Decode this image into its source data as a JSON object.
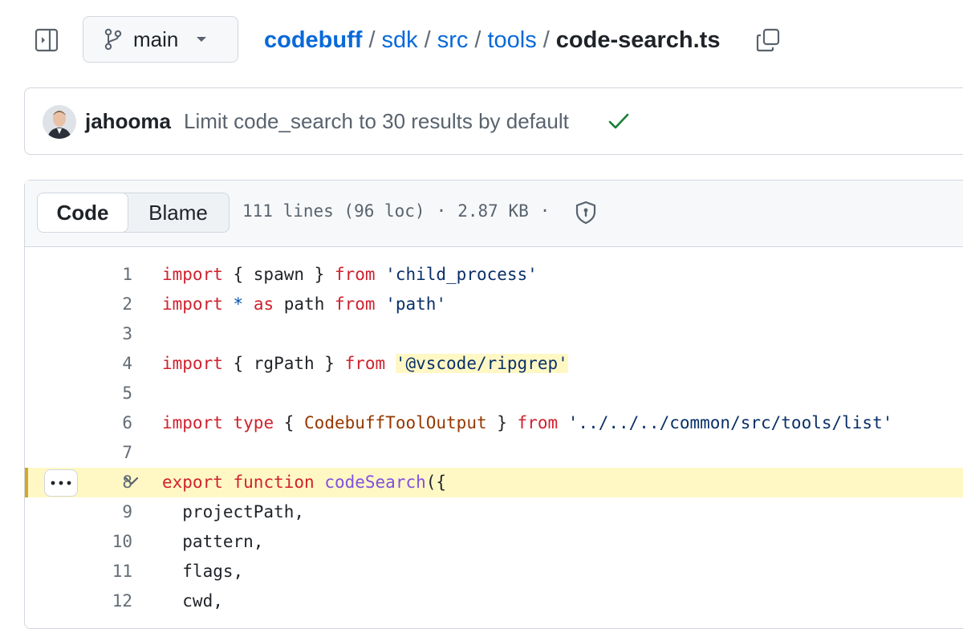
{
  "branch": {
    "name": "main"
  },
  "breadcrumb": {
    "repo": "codebuff",
    "dirs": [
      "sdk",
      "src",
      "tools"
    ],
    "file": "code-search.ts",
    "separator": "/"
  },
  "commit": {
    "author": "jahooma",
    "message": "Limit code_search to 30 results by default",
    "status": "success"
  },
  "file": {
    "tabs": [
      "Code",
      "Blame"
    ],
    "active_tab": "Code",
    "lines_info": "111 lines (96 loc)",
    "size": "2.87 KB",
    "meta_sep": "·"
  },
  "code": {
    "highlighted_line": 8,
    "lines": [
      {
        "num": "1",
        "tokens": [
          [
            "kw",
            "import"
          ],
          [
            "p",
            " { spawn } "
          ],
          [
            "kw",
            "from"
          ],
          [
            "p",
            " "
          ],
          [
            "str",
            "'child_process'"
          ]
        ]
      },
      {
        "num": "2",
        "tokens": [
          [
            "kw",
            "import"
          ],
          [
            "p",
            " "
          ],
          [
            "op",
            "*"
          ],
          [
            "p",
            " "
          ],
          [
            "kw",
            "as"
          ],
          [
            "p",
            " path "
          ],
          [
            "kw",
            "from"
          ],
          [
            "p",
            " "
          ],
          [
            "str",
            "'path'"
          ]
        ]
      },
      {
        "num": "3",
        "tokens": []
      },
      {
        "num": "4",
        "tokens": [
          [
            "kw",
            "import"
          ],
          [
            "p",
            " { rgPath } "
          ],
          [
            "kw",
            "from"
          ],
          [
            "p",
            " "
          ],
          [
            "strhl",
            "'@vscode/ripgrep'"
          ]
        ]
      },
      {
        "num": "5",
        "tokens": []
      },
      {
        "num": "6",
        "tokens": [
          [
            "kw",
            "import"
          ],
          [
            "p",
            " "
          ],
          [
            "kw",
            "type"
          ],
          [
            "p",
            " { "
          ],
          [
            "ty",
            "CodebuffToolOutput"
          ],
          [
            "p",
            " } "
          ],
          [
            "kw",
            "from"
          ],
          [
            "p",
            " "
          ],
          [
            "str",
            "'../../../common/src/tools/list'"
          ]
        ]
      },
      {
        "num": "7",
        "tokens": []
      },
      {
        "num": "8",
        "tokens": [
          [
            "kw",
            "export"
          ],
          [
            "p",
            " "
          ],
          [
            "kw",
            "function"
          ],
          [
            "p",
            " "
          ],
          [
            "fn",
            "codeSearch"
          ],
          [
            "p",
            "({"
          ]
        ]
      },
      {
        "num": "9",
        "tokens": [
          [
            "p",
            "  projectPath,"
          ]
        ]
      },
      {
        "num": "10",
        "tokens": [
          [
            "p",
            "  pattern,"
          ]
        ]
      },
      {
        "num": "11",
        "tokens": [
          [
            "p",
            "  flags,"
          ]
        ]
      },
      {
        "num": "12",
        "tokens": [
          [
            "p",
            "  cwd,"
          ]
        ]
      }
    ]
  },
  "colors": {
    "link": "#0969da",
    "keyword": "#cf222e",
    "string": "#0a3069",
    "function": "#8250df",
    "type": "#953800",
    "highlight": "#fff8c5",
    "success": "#1a7f37"
  },
  "icons": [
    "sidebar-expand-icon",
    "git-branch-icon",
    "chevron-down-icon",
    "copy-icon",
    "check-icon",
    "shield-icon",
    "kebab-horizontal-icon",
    "fold-chevron-icon"
  ]
}
